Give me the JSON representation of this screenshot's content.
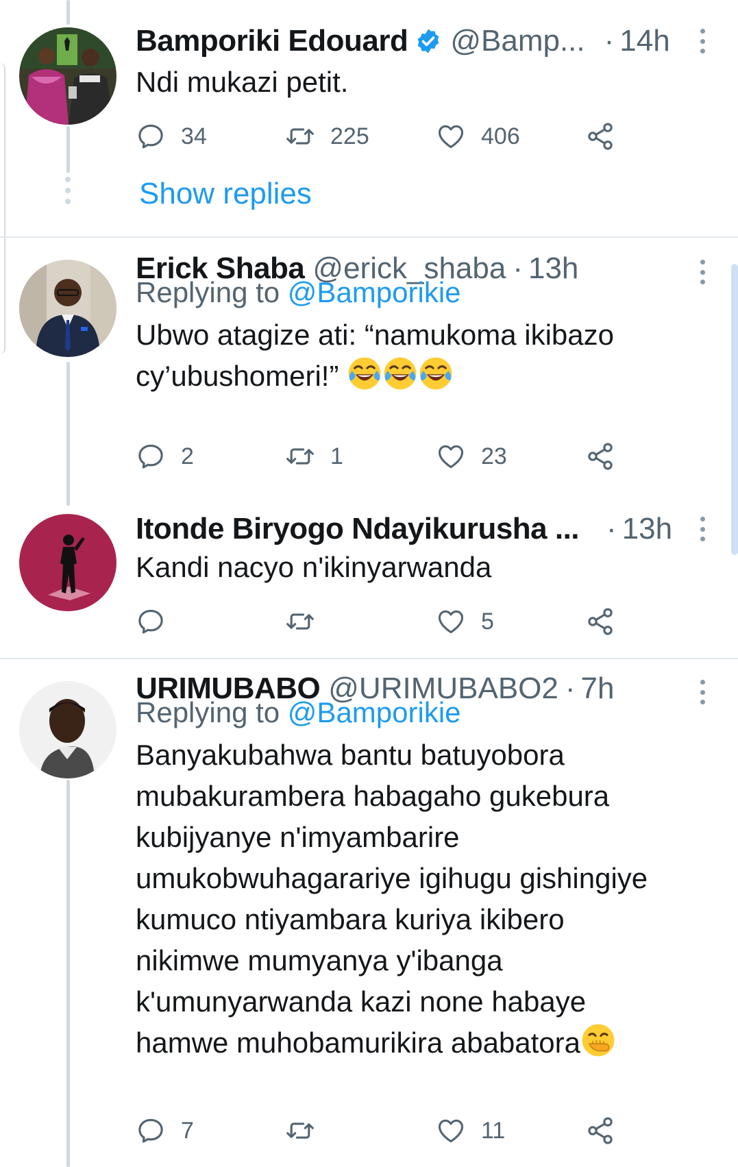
{
  "tweets": [
    {
      "name": "Bamporiki Edouard",
      "verified": true,
      "handle": "@Bamp...",
      "dot": "·",
      "time": "14h",
      "text": "Ndi mukazi petit.",
      "replies": "34",
      "retweets": "225",
      "likes": "406",
      "show_replies": "Show replies"
    },
    {
      "name": "Erick Shaba",
      "handle": "@erick_shaba",
      "dot": "·",
      "time": "13h",
      "replying_prefix": "Replying to",
      "replying_mention": "@Bamporikie",
      "text_line1": "Ubwo atagize ati: “namukoma ikibazo",
      "text_line2": "cy’ubushomeri!”",
      "replies": "2",
      "retweets": "1",
      "likes": "23"
    },
    {
      "name": "Itonde Biryogo Ndayikurusha ...",
      "dot": "·",
      "time": "13h",
      "text": "Kandi nacyo n'ikinyarwanda",
      "replies": "",
      "retweets": "",
      "likes": "5"
    },
    {
      "name": "URIMUBABO",
      "handle": "@URIMUBABO2",
      "dot": "·",
      "time": "7h",
      "replying_prefix": "Replying to",
      "replying_mention": "@Bamporikie",
      "lines": [
        "Banyakubahwa bantu batuyobora",
        "mubakurambera habagaho gukebura",
        "kubijyanye n'imyambarire",
        "umukobwuhagarariye igihugu gishingiye",
        "kumuco ntiyambara kuriya ikibero",
        "nikimwe mumyanya y'ibanga",
        "k'umunyarwanda kazi none habaye",
        "hamwe muhobamurikira ababatora"
      ],
      "replies": "7",
      "retweets": "",
      "likes": "11"
    }
  ],
  "icons": {
    "reply": "reply-icon",
    "retweet": "retweet-icon",
    "like": "heart-icon",
    "share": "share-icon",
    "more": "more-vertical-icon",
    "verified": "verified-badge-icon",
    "laugh": "face-with-tears-of-joy-emoji",
    "hand_over_mouth": "face-with-hand-over-mouth-emoji"
  },
  "colors": {
    "accent": "#1d9bf0",
    "secondary_text": "#536471",
    "primary_text": "#14171a",
    "thread_line": "#cfd9de"
  }
}
